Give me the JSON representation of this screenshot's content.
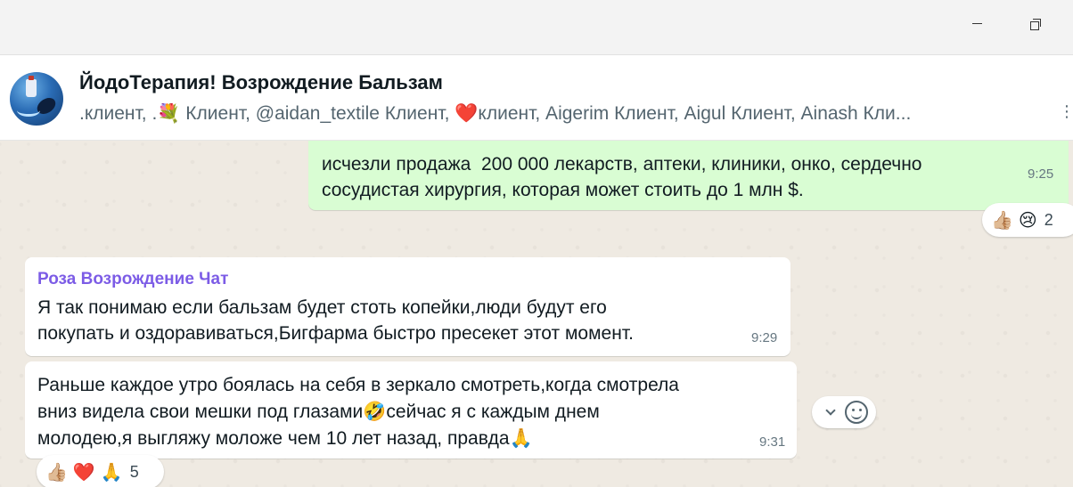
{
  "chat": {
    "title": "ЙодоТерапия! Возрождение Бальзам",
    "members": ".клиент, .💐 Клиент, @aidan_textile Клиент, ❤️клиент, Aigerim Клиент, Aigul Клиент, Ainash Кли..."
  },
  "messages": [
    {
      "direction": "outgoing",
      "text": "исчезли продажа  200 000 лекарств, аптеки, клиники, онко, сердечно\nсосудистая хирургия, которая может стоить до 1 млн $.",
      "time": "9:25",
      "reactions": {
        "emojis": [
          "👍🏼",
          "😢"
        ],
        "count": "2"
      }
    },
    {
      "direction": "incoming",
      "sender": "Роза Возрождение Чат",
      "sender_color": "#7c5ce6",
      "text": "Я так понимаю если бальзам будет стоть копейки,люди будут его\nпокупать и оздоравиваться,Бигфарма быстро пресекет этот момент.",
      "time": "9:29"
    },
    {
      "direction": "incoming",
      "text": "Раньше каждое утро боялась на себя в зеркало смотреть,когда смотрела\nвниз видела свои мешки под глазами🤣сейчас я с каждым днем\nмолодею,я выгляжу моложе чем 10 лет назад, правда🙏",
      "time": "9:31",
      "reactions": {
        "emojis": [
          "👍🏼",
          "❤️",
          "🙏"
        ],
        "count": "5"
      }
    }
  ],
  "colors": {
    "outgoing_bubble": "#d9fdd3",
    "incoming_bubble": "#ffffff",
    "chat_background": "#efeae2"
  },
  "icons": [
    "minimize-icon",
    "restore-icon",
    "more-icon",
    "chevron-down-icon",
    "emoji-icon"
  ]
}
